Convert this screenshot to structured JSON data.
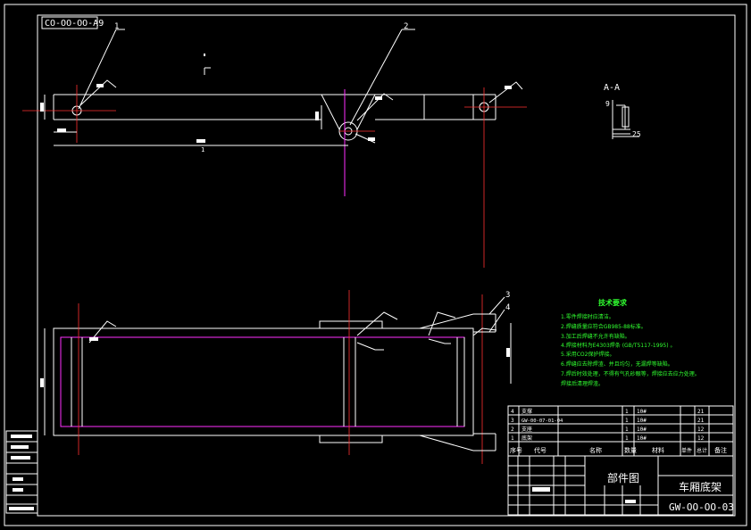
{
  "drawing_code": "CO-OO-OO-A9",
  "views": {
    "section_label": "A-A",
    "section_dims": [
      "9",
      "25"
    ],
    "balloons": [
      "1",
      "2",
      "3",
      "4"
    ],
    "dim_bottom": "1"
  },
  "tech_requirements": {
    "title": "技术要求",
    "items": [
      "1.零件焊接时应清洁。",
      "2.焊缝质量应符合GB985-88标准。",
      "3.加工后焊缝不允许有缺陷。",
      "4.焊接材料为E4303焊条 (GB/T5117-1995) 。",
      "5.采用CO2保护焊接。",
      "6.焊缝应去除焊渣、并且均匀，无漏焊等缺陷。",
      "7.焊后时效处理，不得有气孔砂眼等，焊接应去应力处理。",
      "焊接后清理焊渣。"
    ]
  },
  "bom": {
    "rows": [
      [
        "4",
        "支撑",
        "",
        "1",
        "10#",
        "",
        "21",
        ""
      ],
      [
        "3",
        "GW-00-07-01-04",
        "",
        "1",
        "10#",
        "",
        "21",
        ""
      ],
      [
        "2",
        "支座",
        "",
        "1",
        "10#",
        "",
        "12",
        ""
      ],
      [
        "1",
        "底架",
        "",
        "1",
        "10#",
        "",
        "12",
        ""
      ]
    ],
    "headers": [
      "序号",
      "代号",
      "名称",
      "数量",
      "材料",
      "单件",
      "总计",
      "备注"
    ]
  },
  "title_block": {
    "drawing_type": "部件图",
    "part_name": "车厢底架",
    "drawing_number": "GW-OO-OO-03"
  }
}
